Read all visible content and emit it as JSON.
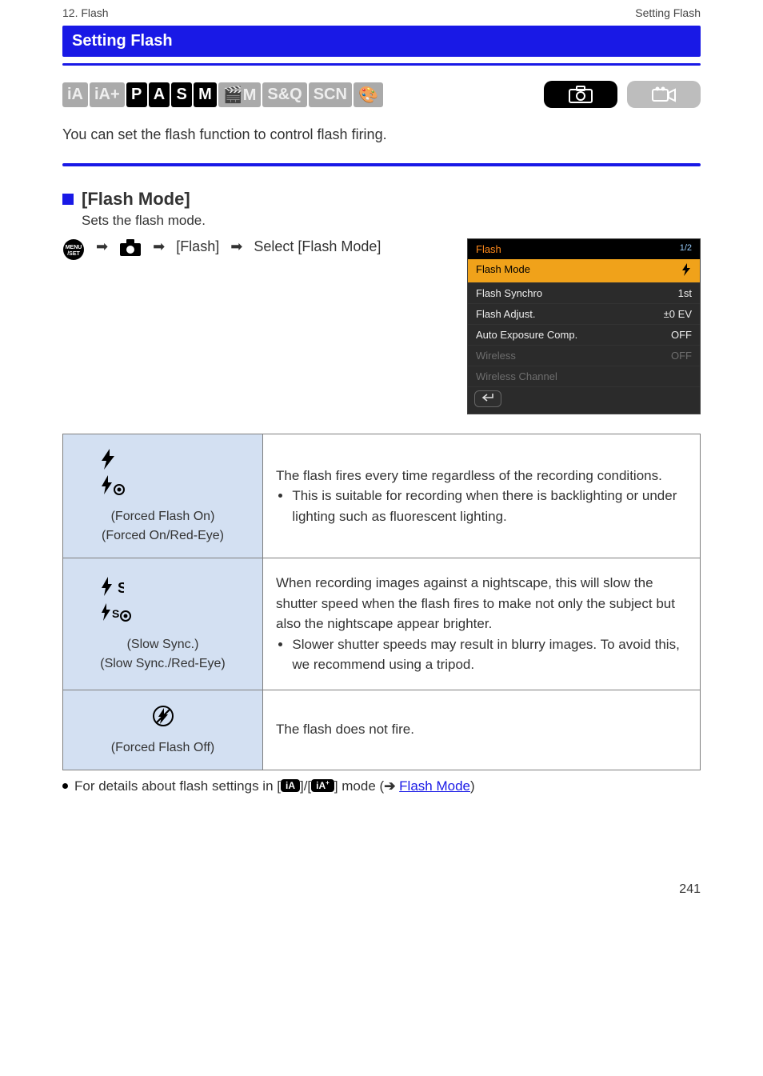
{
  "header": {
    "chapter": "12. Flash",
    "breadcrumb": "Setting Flash"
  },
  "banner": "Setting Flash",
  "modes": {
    "dial": [
      "iA",
      "iA+",
      "P",
      "A",
      "S",
      "M",
      "🎬M",
      "S&Q",
      "SCN",
      "🎨"
    ],
    "dial_enabled": [
      false,
      false,
      true,
      true,
      true,
      true,
      false,
      false,
      false,
      false
    ],
    "right_photo_enabled": true,
    "right_video_enabled": false
  },
  "intro_text": "You can set the flash function to control flash firing.",
  "section_title": "[Flash Mode]",
  "section_subtitle": "Sets the flash mode.",
  "menu_path": {
    "menu_label": "[Flash]",
    "arrow_label": "Select [Flash Mode]",
    "arrows": [
      "➡",
      "➡",
      "➡"
    ]
  },
  "screenshot": {
    "title": "Flash",
    "page_indicator": "1/2",
    "rows": [
      {
        "label": "Flash Mode",
        "value_icon": "flash",
        "selected": true,
        "enabled": true
      },
      {
        "label": "Flash Synchro",
        "value": "1st",
        "selected": false,
        "enabled": true
      },
      {
        "label": "Flash Adjust.",
        "value": "±0  EV",
        "selected": false,
        "enabled": true
      },
      {
        "label": "Auto Exposure Comp.",
        "value": "OFF",
        "selected": false,
        "enabled": true
      },
      {
        "label": "Wireless",
        "value": "OFF",
        "selected": false,
        "enabled": false
      },
      {
        "label": "Wireless Channel",
        "value": "",
        "selected": false,
        "enabled": false
      }
    ],
    "back_icon_label": "back"
  },
  "table": [
    {
      "symbols": [
        "flash",
        "flash-eye"
      ],
      "label": "(Forced Flash On)",
      "sub": "(Forced On/Red-Eye)",
      "desc_lines": [
        "The flash fires every time regardless of the recording conditions.",
        "This is suitable for recording when there is backlighting or under lighting such as fluorescent lighting."
      ]
    },
    {
      "symbols": [
        "flash-s",
        "flash-s-eye"
      ],
      "label": "(Slow Sync.)",
      "sub": "(Slow Sync./Red-Eye)",
      "desc_lines": [
        "When recording images against a nightscape, this will slow the shutter speed when the flash fires to make not only the subject but also the nightscape appear brighter.",
        "Slower shutter speeds may result in blurry images. To avoid this, we recommend using a tripod."
      ]
    },
    {
      "symbols": [
        "flash-off"
      ],
      "label": "(Forced Flash Off)",
      "sub": "",
      "desc_lines": [
        "The flash does not fire."
      ]
    }
  ],
  "note": {
    "prefix": "For details about flash settings in [",
    "mid": "]/[",
    "desc_suffix": "] mode (",
    "link_label": "Flash Mode",
    "end": ")"
  },
  "page_number": "241"
}
